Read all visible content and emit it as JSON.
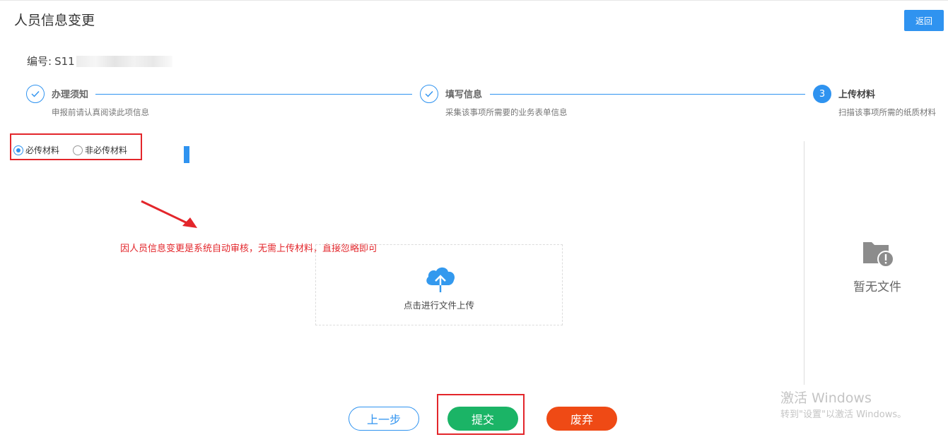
{
  "header": {
    "title": "人员信息变更",
    "back_label": "返回"
  },
  "serial": {
    "label": "编号:",
    "value_visible": "S11"
  },
  "steps": [
    {
      "title": "办理须知",
      "desc": "申报前请认真阅读此项信息",
      "state": "done"
    },
    {
      "title": "填写信息",
      "desc": "采集该事项所需要的业务表单信息",
      "state": "done"
    },
    {
      "number": "3",
      "title": "上传材料",
      "desc": "扫描该事项所需的纸质材料",
      "state": "active"
    }
  ],
  "material_filter": {
    "options": [
      {
        "label": "必传材料",
        "checked": true
      },
      {
        "label": "非必传材料",
        "checked": false
      }
    ]
  },
  "annotation": "因人员信息变更是系统自动审核，无需上传材料，直接忽略即可",
  "upload": {
    "label": "点击进行文件上传",
    "icon": "cloud-upload-icon"
  },
  "preview": {
    "empty_label": "暂无文件",
    "icon": "folder-warning-icon"
  },
  "watermark": {
    "line1": "激活 Windows",
    "line2": "转到\"设置\"以激活 Windows。"
  },
  "actions": {
    "prev_label": "上一步",
    "submit_label": "提交",
    "abandon_label": "废弃"
  },
  "colors": {
    "primary": "#2f93f0",
    "success": "#1bb466",
    "danger": "#ef4a15",
    "highlight": "#e3262b"
  }
}
